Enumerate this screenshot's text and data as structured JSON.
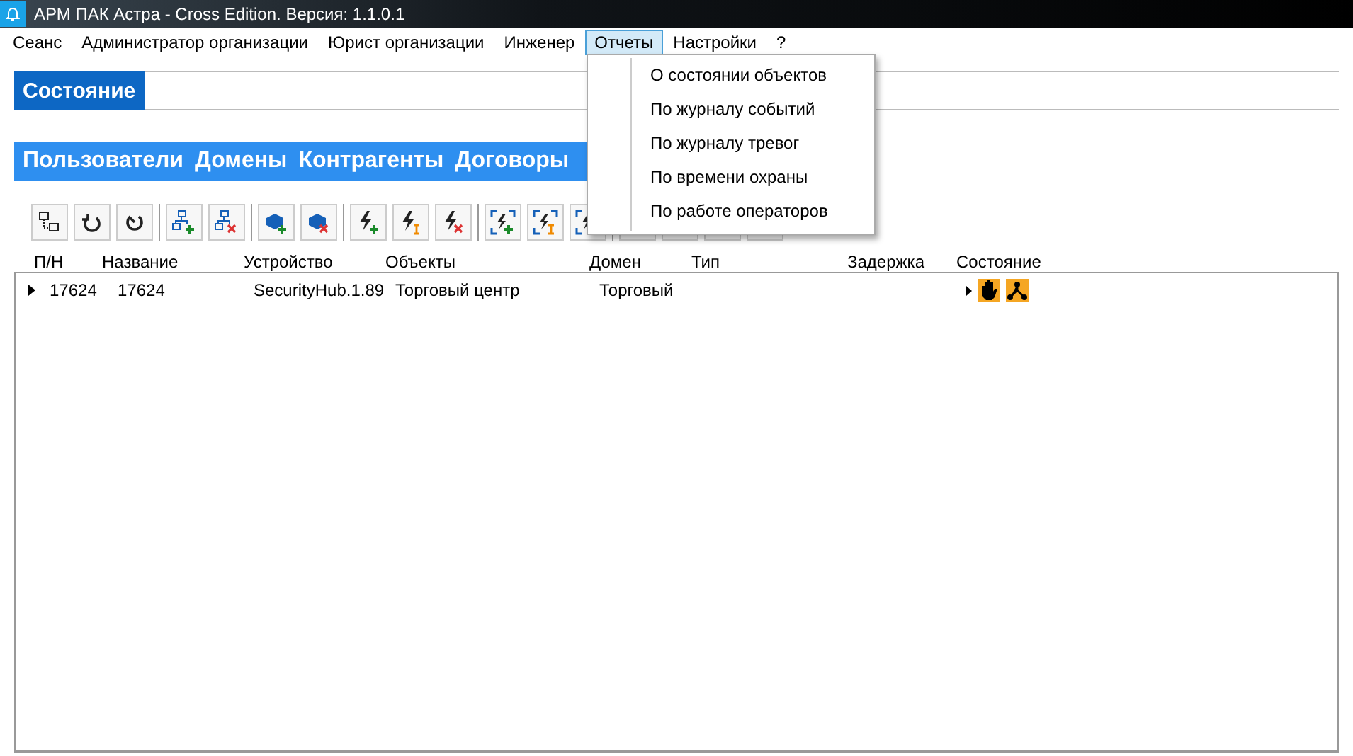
{
  "window": {
    "title": "АРМ ПАК Астра - Cross Edition. Версия: 1.1.0.1"
  },
  "menu": [
    {
      "label": "Сеанс",
      "selected": false
    },
    {
      "label": "Администратор организации",
      "selected": false
    },
    {
      "label": "Юрист организации",
      "selected": false
    },
    {
      "label": "Инженер",
      "selected": false
    },
    {
      "label": "Отчеты",
      "selected": true
    },
    {
      "label": "Настройки",
      "selected": false
    },
    {
      "label": "?",
      "selected": false
    }
  ],
  "dropdown": [
    "О состоянии объектов",
    "По журналу событий",
    "По журналу тревог",
    "По времени охраны",
    "По работе операторов"
  ],
  "state_tab": "Состояние",
  "sections": [
    "Пользователи",
    "Домены",
    "Контрагенты",
    "Договоры"
  ],
  "toolbar": [
    {
      "kind": "network"
    },
    {
      "kind": "refresh"
    },
    {
      "kind": "timer"
    },
    {
      "kind": "sep"
    },
    {
      "kind": "tree-add"
    },
    {
      "kind": "tree-del"
    },
    {
      "kind": "sep"
    },
    {
      "kind": "cube-add"
    },
    {
      "kind": "cube-del"
    },
    {
      "kind": "sep"
    },
    {
      "kind": "bolt-add"
    },
    {
      "kind": "bolt-edit"
    },
    {
      "kind": "bolt-del"
    },
    {
      "kind": "sep"
    },
    {
      "kind": "frame-add"
    },
    {
      "kind": "frame-edit"
    },
    {
      "kind": "frame-del"
    },
    {
      "kind": "sep"
    },
    {
      "kind": "hidden"
    },
    {
      "kind": "hidden"
    },
    {
      "kind": "hidden"
    },
    {
      "kind": "hidden"
    }
  ],
  "table": {
    "columns": [
      "П/Н",
      "Название",
      "Устройство",
      "Объекты",
      "Домен",
      "Тип",
      "Задержка",
      "Состояние"
    ],
    "rows": [
      {
        "cells": [
          "17624",
          "17624",
          "SecurityHub.1.89",
          "Торговый центр",
          "Торговый",
          "",
          ""
        ],
        "expanded": false
      }
    ]
  }
}
